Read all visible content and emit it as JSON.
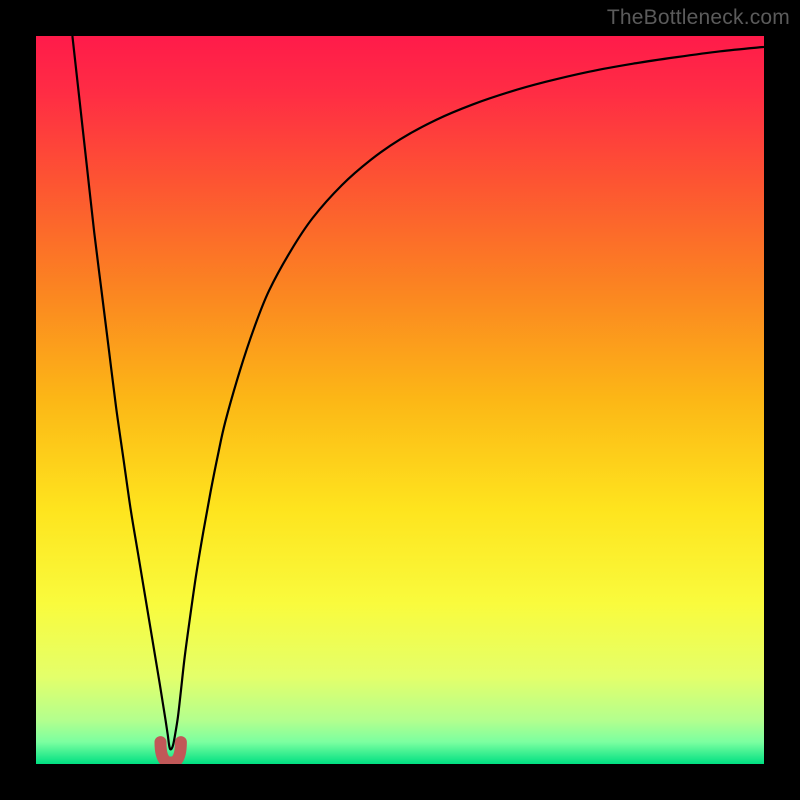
{
  "watermark": "TheBottleneck.com",
  "chart_data": {
    "type": "line",
    "title": "",
    "xlabel": "",
    "ylabel": "",
    "xlim": [
      0,
      100
    ],
    "ylim": [
      0,
      100
    ],
    "grid": false,
    "legend": false,
    "background_gradient": {
      "stops": [
        {
          "offset": 0.0,
          "color": "#ff1b4a"
        },
        {
          "offset": 0.08,
          "color": "#ff2d44"
        },
        {
          "offset": 0.2,
          "color": "#fd5432"
        },
        {
          "offset": 0.35,
          "color": "#fb8521"
        },
        {
          "offset": 0.5,
          "color": "#fcb716"
        },
        {
          "offset": 0.65,
          "color": "#fee41e"
        },
        {
          "offset": 0.78,
          "color": "#f9fb3d"
        },
        {
          "offset": 0.88,
          "color": "#e4ff6a"
        },
        {
          "offset": 0.94,
          "color": "#b3ff8e"
        },
        {
          "offset": 0.97,
          "color": "#7bffa0"
        },
        {
          "offset": 1.0,
          "color": "#00e082"
        }
      ]
    },
    "series": [
      {
        "name": "bottleneck-curve",
        "stroke": "#000000",
        "stroke_width": 2.2,
        "x": [
          5,
          6,
          7,
          8,
          9,
          10,
          11,
          12,
          13,
          14,
          15,
          15.5,
          16,
          16.5,
          17,
          17.4,
          17.8,
          18.1,
          18.3,
          18.5,
          18.8,
          19.1,
          19.5,
          19.9,
          20.4,
          21,
          22,
          23,
          24,
          25,
          26,
          28,
          30,
          32,
          35,
          38,
          42,
          46,
          50,
          55,
          60,
          65,
          70,
          76,
          82,
          88,
          94,
          100
        ],
        "y": [
          100,
          91,
          82,
          73,
          65,
          57,
          49,
          42,
          35,
          29,
          23,
          20,
          17,
          14,
          11,
          8.5,
          6,
          4,
          2.5,
          2,
          2.5,
          4,
          6.5,
          10,
          14.5,
          19,
          26,
          32,
          37.5,
          42.5,
          47,
          54,
          60,
          65,
          70.5,
          75,
          79.5,
          83,
          85.8,
          88.5,
          90.6,
          92.3,
          93.7,
          95.1,
          96.2,
          97.1,
          97.9,
          98.5
        ]
      }
    ],
    "marker": {
      "name": "dip-marker",
      "shape": "u",
      "color": "#c15858",
      "x_center": 18.5,
      "x_half_width": 1.4,
      "y_bottom": 0.2,
      "y_top": 3.0,
      "stroke_width": 12
    }
  }
}
